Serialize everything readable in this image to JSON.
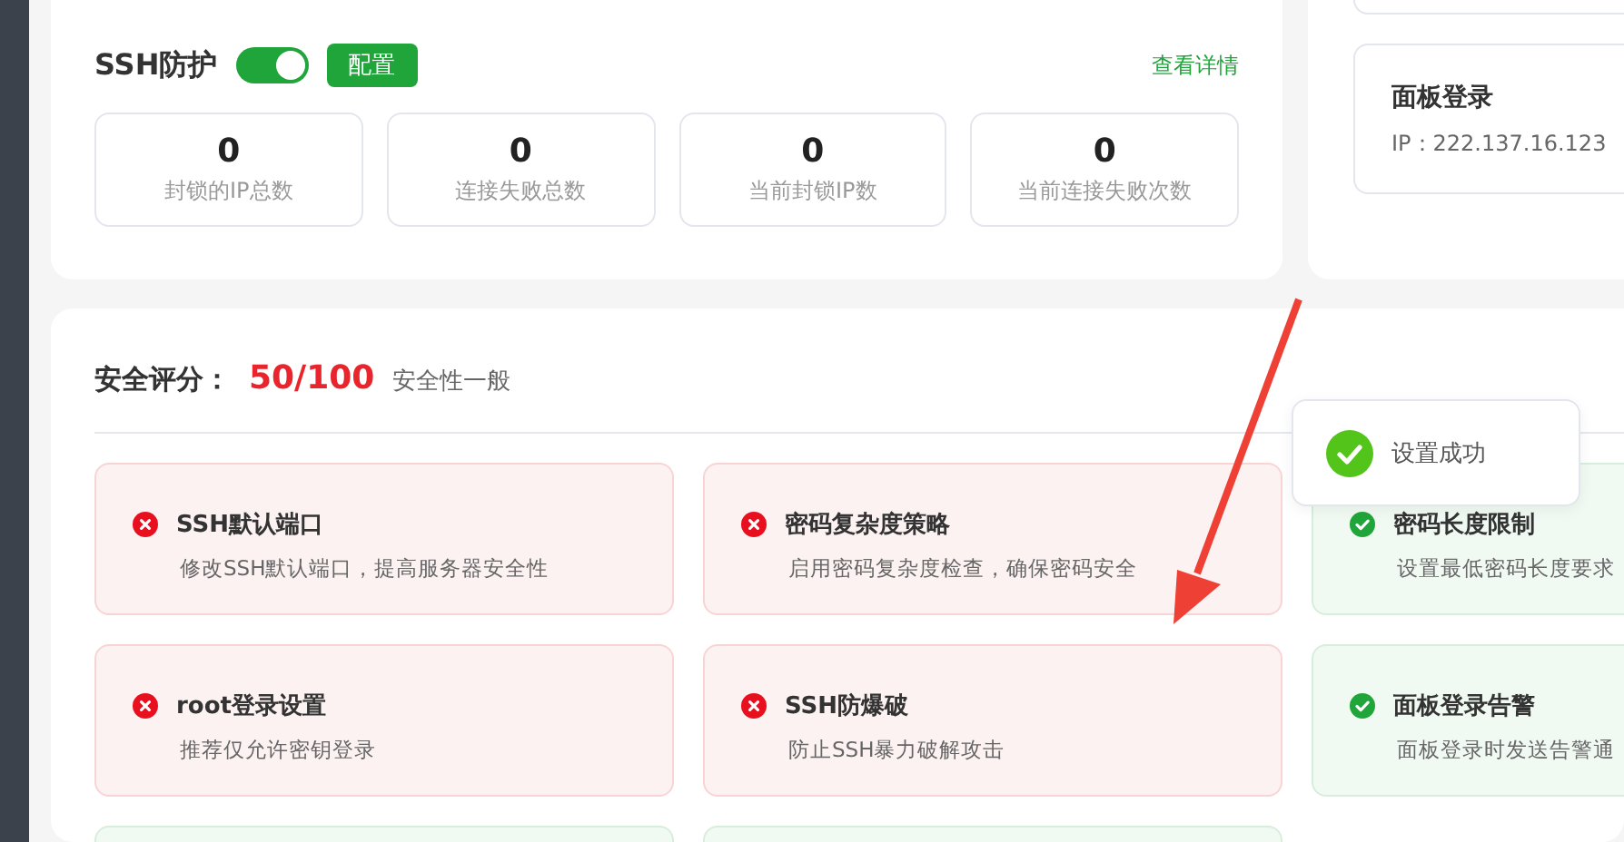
{
  "ssh_protection": {
    "title": "SSH防护",
    "enabled": true,
    "config_button": "配置",
    "details_link": "查看详情",
    "stats": [
      {
        "value": "0",
        "label": "封锁的IP总数"
      },
      {
        "value": "0",
        "label": "连接失败总数"
      },
      {
        "value": "0",
        "label": "当前封锁IP数"
      },
      {
        "value": "0",
        "label": "当前连接失败次数"
      }
    ]
  },
  "panel_login": {
    "title": "面板登录",
    "ip": "IP：222.137.16.123"
  },
  "security": {
    "label": "安全评分：",
    "score": "50/100",
    "rating": "安全性一般",
    "items": [
      {
        "kind": "fail",
        "title": "SSH默认端口",
        "description": "修改SSH默认端口，提高服务器安全性"
      },
      {
        "kind": "fail",
        "title": "密码复杂度策略",
        "description": "启用密码复杂度检查，确保密码安全"
      },
      {
        "kind": "pass",
        "title": "密码长度限制",
        "description": "设置最低密码长度要求"
      },
      {
        "kind": "fail",
        "title": "root登录设置",
        "description": "推荐仅允许密钥登录"
      },
      {
        "kind": "fail",
        "title": "SSH防爆破",
        "description": "防止SSH暴力破解攻击"
      },
      {
        "kind": "pass",
        "title": "面板登录告警",
        "description": "面板登录时发送告警通"
      },
      {
        "kind": "pass"
      },
      {
        "kind": "pass"
      }
    ]
  },
  "toast": {
    "kind": "success",
    "message": "设置成功"
  }
}
